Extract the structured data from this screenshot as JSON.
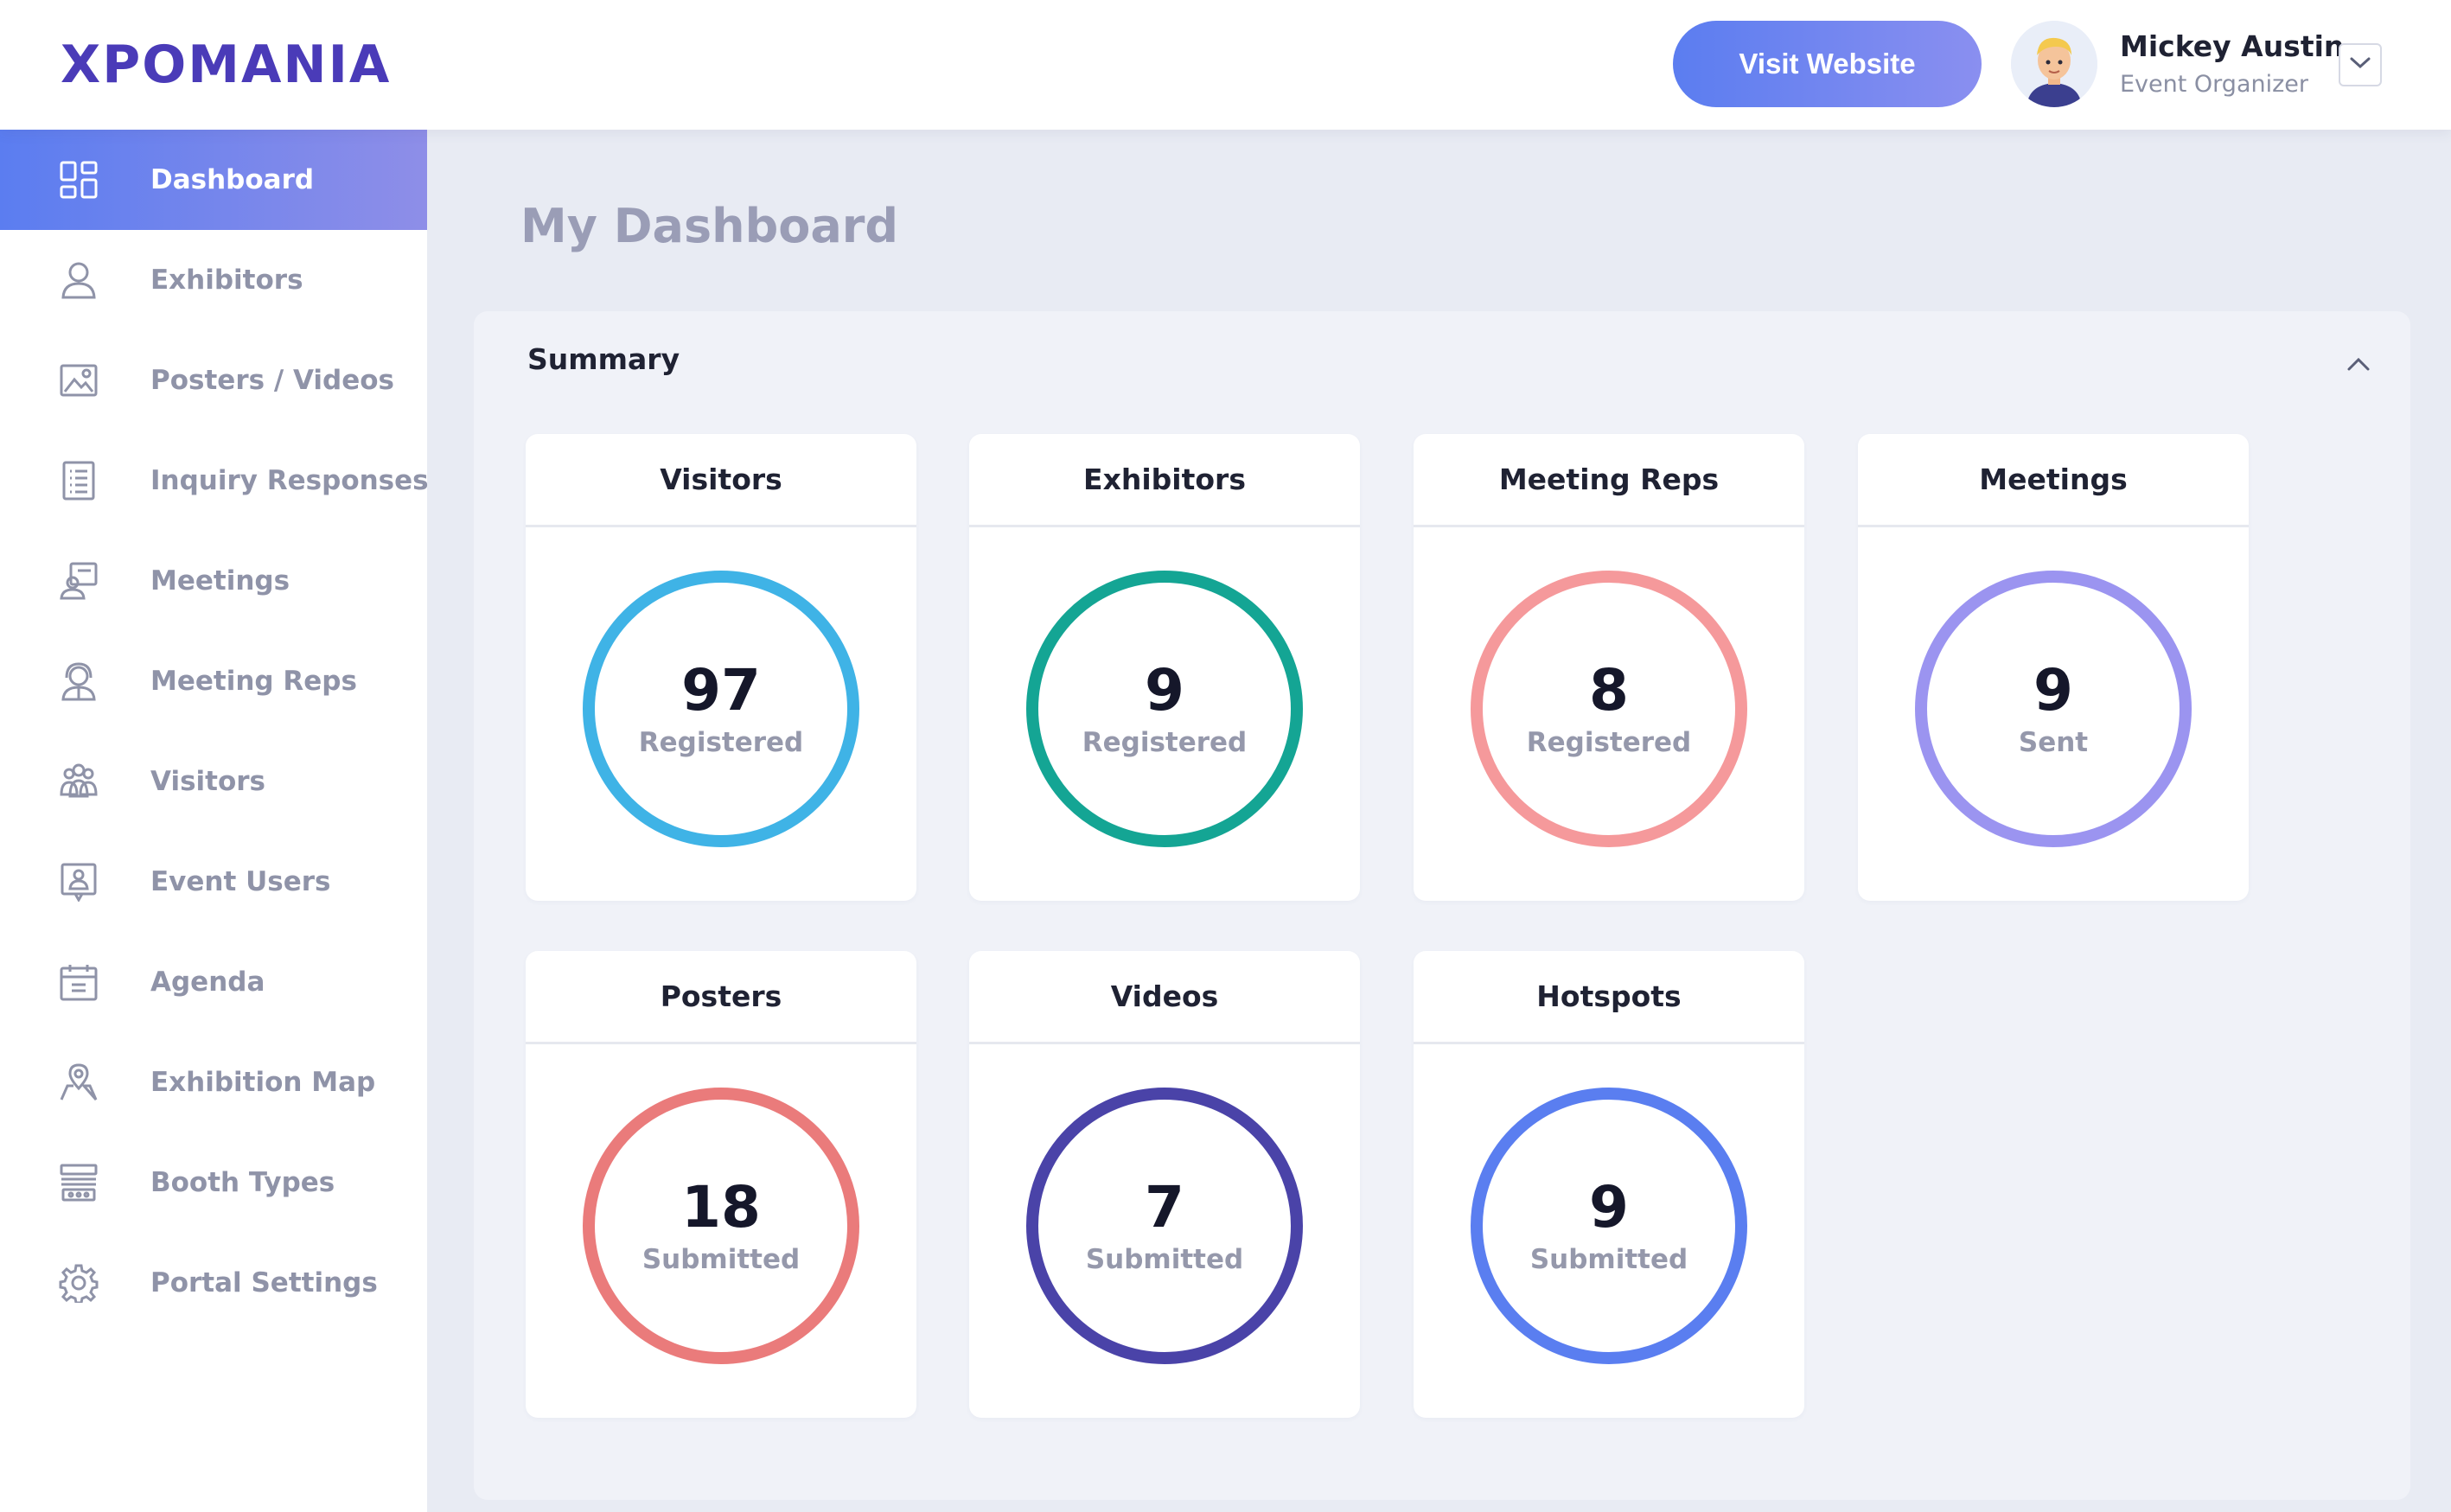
{
  "header": {
    "logo_text": "XPOMANIA",
    "visit_button": "Visit Website",
    "user_name": "Mickey Austin",
    "user_role": "Event Organizer"
  },
  "sidebar": {
    "items": [
      {
        "label": "Dashboard",
        "icon": "dashboard-icon",
        "active": true
      },
      {
        "label": "Exhibitors",
        "icon": "user-icon"
      },
      {
        "label": "Posters / Videos",
        "icon": "image-icon"
      },
      {
        "label": "Inquiry Responses",
        "icon": "list-document-icon"
      },
      {
        "label": "Meetings",
        "icon": "meeting-board-icon"
      },
      {
        "label": "Meeting Reps",
        "icon": "headset-rep-icon"
      },
      {
        "label": "Visitors",
        "icon": "group-icon"
      },
      {
        "label": "Event Users",
        "icon": "badge-user-icon"
      },
      {
        "label": "Agenda",
        "icon": "calendar-icon"
      },
      {
        "label": "Exhibition Map",
        "icon": "map-pin-icon"
      },
      {
        "label": "Booth Types",
        "icon": "booth-icon"
      },
      {
        "label": "Portal Settings",
        "icon": "gear-icon"
      }
    ]
  },
  "main": {
    "page_title": "My Dashboard",
    "summary_title": "Summary",
    "cards": [
      {
        "title": "Visitors",
        "value": "97",
        "sub": "Registered",
        "color": "#3fb3e6"
      },
      {
        "title": "Exhibitors",
        "value": "9",
        "sub": "Registered",
        "color": "#14a594"
      },
      {
        "title": "Meeting Reps",
        "value": "8",
        "sub": "Registered",
        "color": "#f5999b"
      },
      {
        "title": "Meetings",
        "value": "9",
        "sub": "Sent",
        "color": "#9b94f0"
      },
      {
        "title": "Posters",
        "value": "18",
        "sub": "Submitted",
        "color": "#ea7b7b"
      },
      {
        "title": "Videos",
        "value": "7",
        "sub": "Submitted",
        "color": "#4a43a8"
      },
      {
        "title": "Hotspots",
        "value": "9",
        "sub": "Submitted",
        "color": "#5a7ef0"
      }
    ]
  },
  "colors": {
    "accent": "#5b7df0",
    "brand": "#4a3bb8",
    "background": "#e8ebf3"
  }
}
